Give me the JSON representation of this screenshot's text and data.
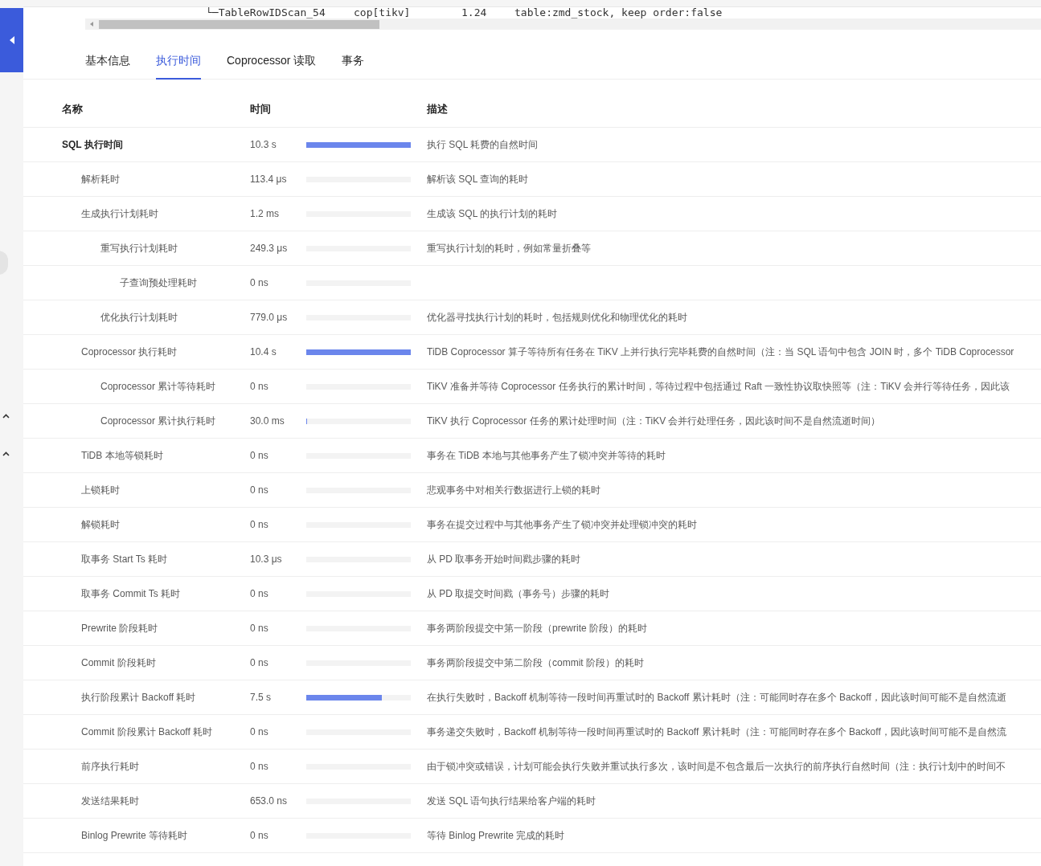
{
  "plan_line": {
    "operator": "└─TableRowIDScan_54",
    "task": "cop[tikv]",
    "est_rows": "1.24",
    "info": "table:zmd_stock, keep order:false"
  },
  "tabs": [
    {
      "label": "基本信息",
      "selected": false
    },
    {
      "label": "执行时间",
      "selected": true
    },
    {
      "label": "Coprocessor 读取",
      "selected": false
    },
    {
      "label": "事务",
      "selected": false
    }
  ],
  "table": {
    "columns": [
      "名称",
      "时间",
      "描述"
    ],
    "rows": [
      {
        "name": "SQL 执行时间",
        "time": "10.3 s",
        "level": 1,
        "description": "执行 SQL 耗费的自然时间",
        "children": [
          {
            "name": "解析耗时",
            "time": "113.4 μs",
            "level": 0,
            "description": "解析该 SQL 查询的耗时"
          },
          {
            "name": "生成执行计划耗时",
            "time": "1.2 ms",
            "level": 0,
            "description": "生成该 SQL 的执行计划的耗时",
            "children": [
              {
                "name": "重写执行计划耗时",
                "time": "249.3 μs",
                "level": 0,
                "description": "重写执行计划的耗时，例如常量折叠等",
                "children": [
                  {
                    "name": "子查询预处理耗时",
                    "time": "0 ns",
                    "level": 0
                  }
                ]
              },
              {
                "name": "优化执行计划耗时",
                "time": "779.0 μs",
                "level": 0,
                "description": "优化器寻找执行计划的耗时，包括规则优化和物理优化的耗时"
              }
            ]
          },
          {
            "name": "Coprocessor 执行耗时",
            "time": "10.4 s",
            "level": 1,
            "description": "TiDB Coprocessor 算子等待所有任务在 TiKV 上并行执行完毕耗费的自然时间（注：当 SQL 语句中包含 JOIN 时，多个 TiDB Coprocessor",
            "children": [
              {
                "name": "Coprocessor 累计等待耗时",
                "time": "0 ns",
                "level": 0,
                "description": "TiKV 准备并等待 Coprocessor 任务执行的累计时间，等待过程中包括通过 Raft 一致性协议取快照等（注：TiKV 会并行等待任务，因此该"
              },
              {
                "name": "Coprocessor 累计执行耗时",
                "time": "30.0 ms",
                "level": 0.01,
                "description": "TiKV 执行 Coprocessor 任务的累计处理时间（注：TiKV 会并行处理任务，因此该时间不是自然流逝时间）"
              }
            ]
          },
          {
            "name": "TiDB 本地等锁耗时",
            "time": "0 ns",
            "level": 0,
            "description": "事务在 TiDB 本地与其他事务产生了锁冲突并等待的耗时"
          },
          {
            "name": "上锁耗时",
            "time": "0 ns",
            "level": 0,
            "description": "悲观事务中对相关行数据进行上锁的耗时"
          },
          {
            "name": "解锁耗时",
            "time": "0 ns",
            "level": 0,
            "description": "事务在提交过程中与其他事务产生了锁冲突并处理锁冲突的耗时"
          },
          {
            "name": "取事务 Start Ts 耗时",
            "time": "10.3 μs",
            "level": 0,
            "description": "从 PD 取事务开始时间戳步骤的耗时"
          },
          {
            "name": "取事务 Commit Ts 耗时",
            "time": "0 ns",
            "level": 0,
            "description": "从 PD 取提交时间戳（事务号）步骤的耗时"
          },
          {
            "name": "Prewrite 阶段耗时",
            "time": "0 ns",
            "level": 0,
            "description": "事务两阶段提交中第一阶段（prewrite 阶段）的耗时"
          },
          {
            "name": "Commit 阶段耗时",
            "time": "0 ns",
            "level": 0,
            "description": "事务两阶段提交中第二阶段（commit 阶段）的耗时"
          },
          {
            "name": "执行阶段累计 Backoff 耗时",
            "time": "7.5 s",
            "level": 0.72,
            "description": "在执行失败时，Backoff 机制等待一段时间再重试时的 Backoff 累计耗时（注：可能同时存在多个 Backoff，因此该时间可能不是自然流逝"
          },
          {
            "name": "Commit 阶段累计 Backoff 耗时",
            "time": "0 ns",
            "level": 0,
            "description": "事务递交失败时，Backoff 机制等待一段时间再重试时的 Backoff 累计耗时（注：可能同时存在多个 Backoff，因此该时间可能不是自然流"
          },
          {
            "name": "前序执行耗时",
            "time": "0 ns",
            "level": 0,
            "description": "由于锁冲突或错误，计划可能会执行失败并重试执行多次，该时间是不包含最后一次执行的前序执行自然时间（注：执行计划中的时间不"
          },
          {
            "name": "发送结果耗时",
            "time": "653.0 ns",
            "level": 0,
            "description": "发送 SQL 语句执行结果给客户端的耗时"
          },
          {
            "name": "Binlog Prewrite 等待耗时",
            "time": "0 ns",
            "level": 0,
            "description": "等待 Binlog Prewrite 完成的耗时"
          }
        ]
      }
    ]
  }
}
